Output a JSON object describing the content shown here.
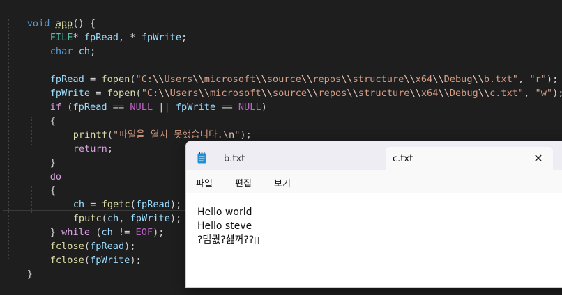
{
  "editor": {
    "lines": [
      [
        "void",
        " ",
        "app",
        "() {"
      ],
      [
        "FILE",
        "* ",
        "fpRead",
        ", * ",
        "fpWrite",
        ";"
      ],
      [
        "char",
        " ",
        "ch",
        ";"
      ],
      [],
      [
        "fpRead",
        " = ",
        "fopen",
        "(",
        "\"C:",
        "\\\\",
        "Users",
        "\\\\",
        "microsoft",
        "\\\\",
        "source",
        "\\\\",
        "repos",
        "\\\\",
        "structure",
        "\\\\",
        "x64",
        "\\\\",
        "Debug",
        "\\\\",
        "b.txt\"",
        ", ",
        "\"r\"",
        ");"
      ],
      [
        "fpWrite",
        " = ",
        "fopen",
        "(",
        "\"C:",
        "\\\\",
        "Users",
        "\\\\",
        "microsoft",
        "\\\\",
        "source",
        "\\\\",
        "repos",
        "\\\\",
        "structure",
        "\\\\",
        "x64",
        "\\\\",
        "Debug",
        "\\\\",
        "c.txt\"",
        ", ",
        "\"w\"",
        ");"
      ],
      [
        "if",
        " (",
        "fpRead",
        " == ",
        "NULL",
        " || ",
        "fpWrite",
        " == ",
        "NULL",
        ")"
      ],
      [
        "{"
      ],
      [
        "printf",
        "(",
        "\"파일을 열지 못했습니다.",
        "\\n",
        "\"",
        ");"
      ],
      [
        "return",
        ";"
      ],
      [
        "}"
      ],
      [
        "do"
      ],
      [
        "{"
      ],
      [
        "ch",
        " = ",
        "fgetc",
        "(",
        "fpRead",
        ");"
      ],
      [
        "fputc",
        "(",
        "ch",
        ", ",
        "fpWrite",
        ");"
      ],
      [
        "} ",
        "while",
        " (",
        "ch",
        " != ",
        "EOF",
        ");"
      ],
      [
        "fclose",
        "(",
        "fpRead",
        ");"
      ],
      [
        "fclose",
        "(",
        "fpWrite",
        ");"
      ],
      [
        "}"
      ]
    ]
  },
  "notepad": {
    "tabs": [
      {
        "label": "b.txt"
      },
      {
        "label": "c.txt"
      }
    ],
    "close_glyph": "✕",
    "menu": [
      "파일",
      "편집",
      "보기"
    ],
    "content": [
      "Hello world",
      "Hello steve",
      "?댐퀎?섎꺼??▯"
    ]
  },
  "colors": {
    "editor_bg": "#1e1e1e",
    "keyword": "#569cd6",
    "control": "#d8a0df",
    "function": "#dcdcaa",
    "type": "#4ec9b0",
    "variable": "#9cdcfe",
    "string": "#d69d85",
    "macro": "#bd63c5"
  }
}
